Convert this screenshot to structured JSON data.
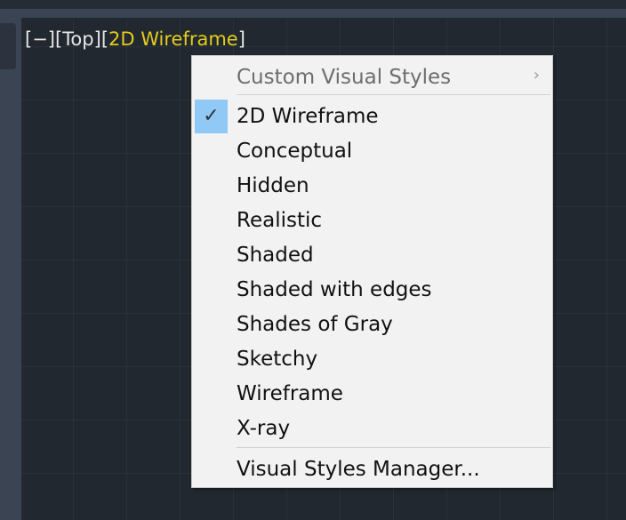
{
  "viewport_label": {
    "minus": "[−]",
    "view": "[Top]",
    "style_open": "[",
    "style": "2D Wireframe",
    "style_close": "]"
  },
  "menu": {
    "submenu": {
      "label": "Custom Visual Styles",
      "arrow": "›"
    },
    "items": [
      {
        "label": "2D Wireframe",
        "checked": true
      },
      {
        "label": "Conceptual"
      },
      {
        "label": "Hidden"
      },
      {
        "label": "Realistic"
      },
      {
        "label": "Shaded"
      },
      {
        "label": "Shaded with edges"
      },
      {
        "label": "Shades of Gray"
      },
      {
        "label": "Sketchy"
      },
      {
        "label": "Wireframe"
      },
      {
        "label": "X-ray"
      }
    ],
    "manager": "Visual Styles Manager...",
    "check_glyph": "✓"
  },
  "colors": {
    "accent": "#e3cc1c",
    "highlight": "#90c8f6"
  }
}
